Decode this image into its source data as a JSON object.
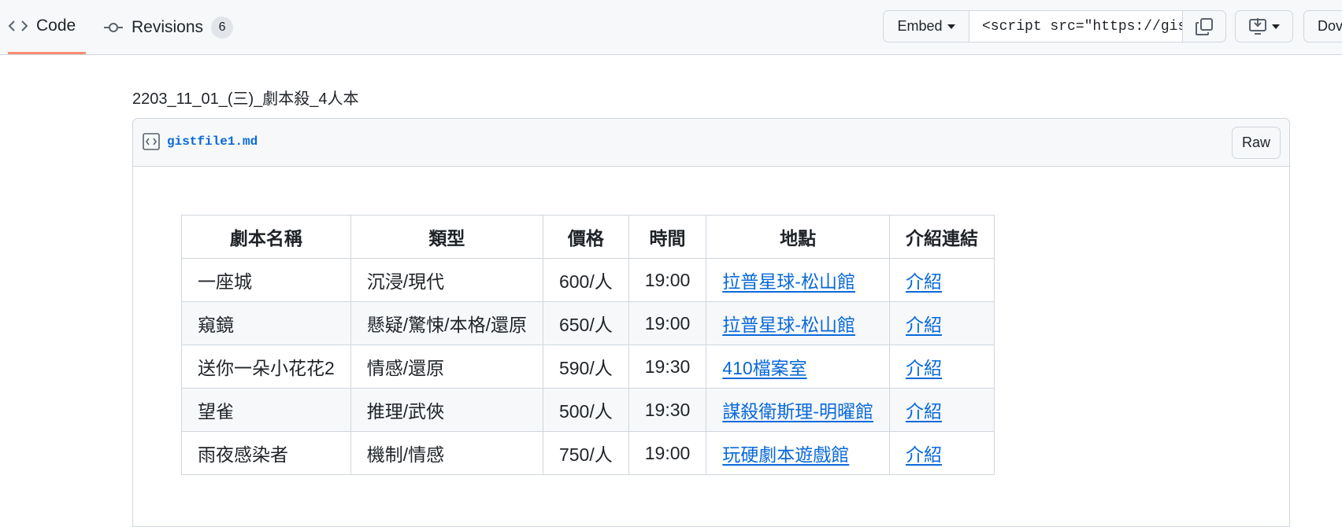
{
  "tabs": {
    "code_label": "Code",
    "revisions_label": "Revisions",
    "revisions_count": "6"
  },
  "toolbar": {
    "embed_label": "Embed",
    "embed_snippet": "<script src=\"https://gis",
    "download_label": "Dov"
  },
  "gist": {
    "description": "2203_11_01_(三)_劇本殺_4人本",
    "file_name": "gistfile1.md",
    "raw_label": "Raw"
  },
  "table": {
    "headers": [
      "劇本名稱",
      "類型",
      "價格",
      "時間",
      "地點",
      "介紹連結"
    ],
    "rows": [
      {
        "name": "一座城",
        "genre": "沉浸/現代",
        "price": "600/人",
        "time": "19:00",
        "location": "拉普星球-松山館",
        "link": "介紹"
      },
      {
        "name": "窺鏡",
        "genre": "懸疑/驚悚/本格/還原",
        "price": "650/人",
        "time": "19:00",
        "location": "拉普星球-松山館",
        "link": "介紹"
      },
      {
        "name": "送你一朵小花花2",
        "genre": "情感/還原",
        "price": "590/人",
        "time": "19:30",
        "location": "410檔案室",
        "link": "介紹"
      },
      {
        "name": "望雀",
        "genre": "推理/武俠",
        "price": "500/人",
        "time": "19:30",
        "location": "謀殺衛斯理-明曜館",
        "link": "介紹"
      },
      {
        "name": "雨夜感染者",
        "genre": "機制/情感",
        "price": "750/人",
        "time": "19:00",
        "location": "玩硬劇本遊戲館",
        "link": "介紹"
      }
    ]
  },
  "colors": {
    "link": "#0969da",
    "tab_underline": "#fd8c73",
    "header_bg": "#f6f8fa",
    "border": "#d0d7de"
  }
}
